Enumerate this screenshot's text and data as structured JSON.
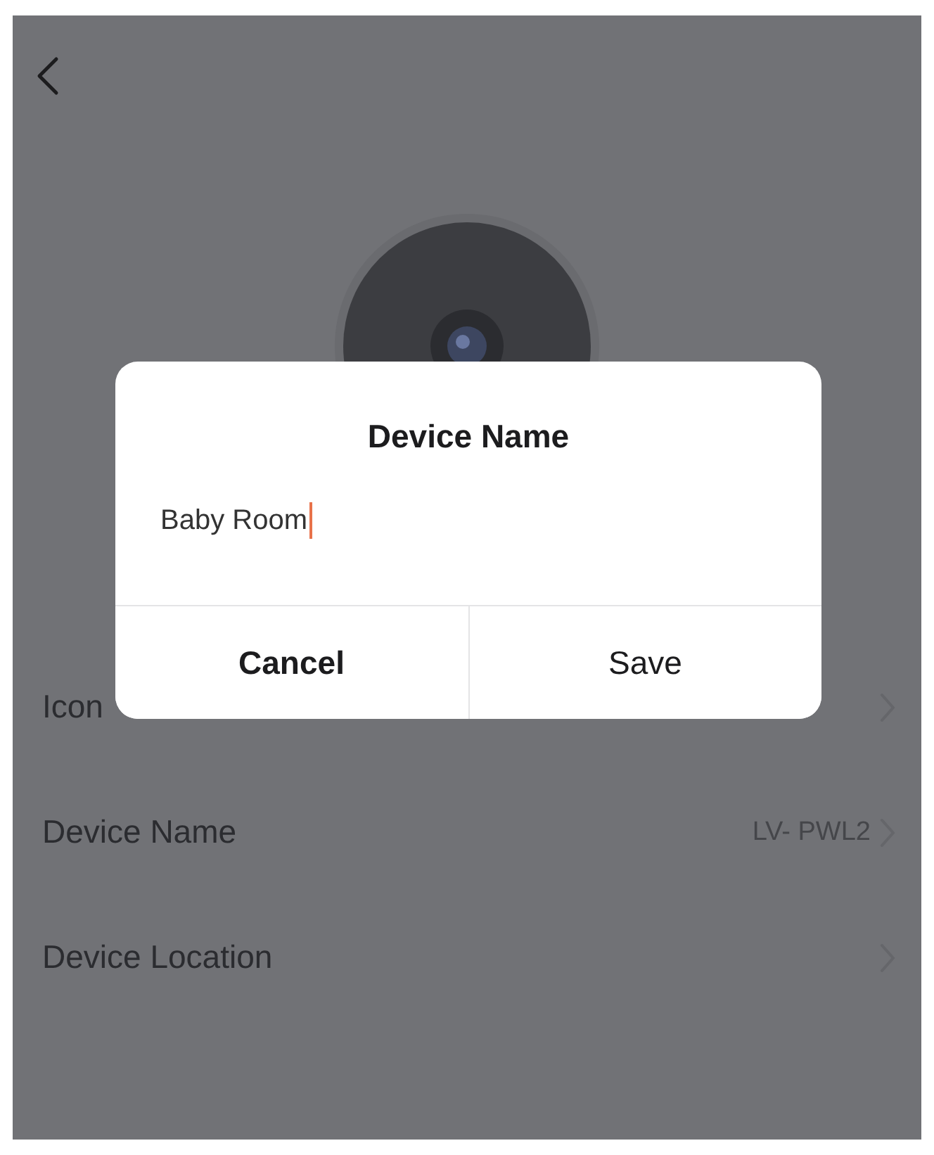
{
  "settings_rows": [
    {
      "label": "Icon"
    },
    {
      "label": "Device Name",
      "value": "LV- PWL2"
    },
    {
      "label": "Device Location"
    }
  ],
  "dialog": {
    "title": "Device Name",
    "field": {
      "value": "Baby Room",
      "focused": true
    },
    "buttons": [
      {
        "label": "Cancel",
        "kind": "cancel"
      },
      {
        "label": "Save",
        "kind": "confirm"
      }
    ]
  }
}
